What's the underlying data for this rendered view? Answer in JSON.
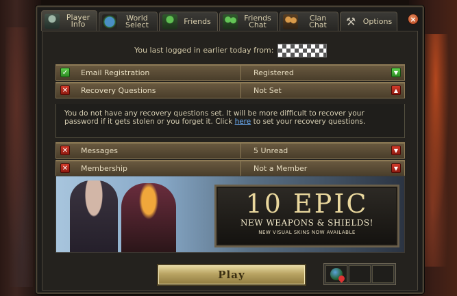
{
  "tabs": [
    {
      "label": "Player\nInfo",
      "icon": "player-icon",
      "active": true
    },
    {
      "label": "World\nSelect",
      "icon": "world-icon"
    },
    {
      "label": "Friends",
      "icon": "friends-icon"
    },
    {
      "label": "Friends\nChat",
      "icon": "friends-chat-icon"
    },
    {
      "label": "Clan\nChat",
      "icon": "clan-chat-icon"
    },
    {
      "label": "Options",
      "icon": "options-icon"
    }
  ],
  "close": {
    "glyph": "×"
  },
  "login": {
    "text": "You last logged in earlier today from:"
  },
  "rows": [
    {
      "name": "Email Registration",
      "value": "Registered",
      "status": "ok",
      "status_glyph": "✓",
      "arrow_glyph": "▼"
    },
    {
      "name": "Recovery Questions",
      "value": "Not Set",
      "status": "bad",
      "status_glyph": "✕",
      "arrow_glyph": "▲"
    },
    {
      "name": "Messages",
      "value": "5 Unread",
      "status": "bad",
      "status_glyph": "✕",
      "arrow_glyph": "▼"
    },
    {
      "name": "Membership",
      "value": "Not a Member",
      "status": "bad",
      "status_glyph": "✕",
      "arrow_glyph": "▼"
    }
  ],
  "recovery_note": {
    "before": "You do not have any recovery questions set. It will be more difficult to recover your password if it gets stolen or you forget it. Click ",
    "link": "here",
    "after": " to set your recovery questions."
  },
  "banner": {
    "big": "10 EPIC",
    "sub": "NEW WEAPONS & SHIELDS!",
    "small": "NEW VISUAL SKINS NOW AVAILABLE"
  },
  "play": {
    "label": "Play"
  },
  "options_glyph": "⚒",
  "colors": {
    "ok": "#3aa62e",
    "bad": "#b8281a",
    "gold": "#e9d79d",
    "link": "#6fb4ff"
  }
}
